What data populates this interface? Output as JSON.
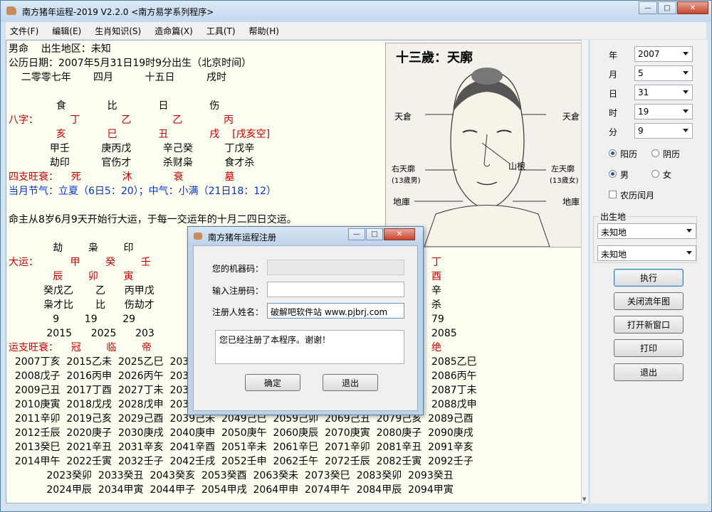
{
  "app": {
    "title": "南方猪年运程-2019  V2.2.0 <南方易学系列程序>",
    "close_glyph": "✕",
    "min_glyph": "—",
    "max_glyph": "□"
  },
  "menu": [
    "文件(F)",
    "编辑(E)",
    "生肖知识(S)",
    "造命篇(X)",
    "工具(T)",
    "帮助(H)"
  ],
  "lines": [
    {
      "t": "男命    出生地区：未知",
      "c": ""
    },
    {
      "t": "公历日期：2007年5月31日19时9分出生（北京时间）",
      "c": ""
    },
    {
      "t": "    二零零七年       四月          十五日          戌时",
      "c": ""
    },
    {
      "t": "",
      "c": ""
    },
    {
      "t": "               食             比             日             伤",
      "c": ""
    },
    {
      "t": "八字：          丁             乙             乙             丙",
      "c": "red"
    },
    {
      "t": "               亥             巳             丑             戌    [戌亥空]",
      "c": "red"
    },
    {
      "t": "             甲壬          庚丙戊          辛己癸          丁戊辛",
      "c": ""
    },
    {
      "t": "             劫印          官伤才          杀财枭          食才杀",
      "c": ""
    },
    {
      "t": "四支旺衰：    死             沐             衰             墓",
      "c": "red"
    },
    {
      "t": "当月节气：立夏（6日5：20）；中气：小满（21日18：12）",
      "c": "blue"
    },
    {
      "t": "",
      "c": ""
    },
    {
      "t": "命主从8岁6月9天开始行大运，于每一交运年的十月二四日交运。",
      "c": ""
    },
    {
      "t": "",
      "c": ""
    },
    {
      "t": "              劫        枭        印",
      "c": ""
    },
    {
      "t": "大运：          甲        癸        壬",
      "c": "red"
    },
    {
      "t": "              辰        卯        寅",
      "c": "red"
    },
    {
      "t": "           癸戊乙       乙      丙甲戊",
      "c": ""
    },
    {
      "t": "           枭才比       比      伤劫才",
      "c": ""
    },
    {
      "t": "              9        19        29",
      "c": ""
    },
    {
      "t": "            2015      2025      203",
      "c": ""
    },
    {
      "t": "运支旺衰：    冠        临        帝",
      "c": "red"
    },
    {
      "t": "  2007丁亥  2015乙未  2025乙巳  203",
      "c": ""
    },
    {
      "t": "  2008戊子  2016丙申  2026丙午  203",
      "c": ""
    },
    {
      "t": "  2009己丑  2017丁酉  2027丁未  203",
      "c": ""
    },
    {
      "t": "  2010庚寅  2018戊戌  2028戊申  203",
      "c": ""
    },
    {
      "t": "  2011辛卯  2019己亥  2029己酉  2039己未  2049己巳  2059己卯  2069己丑  2079己亥  2089己酉",
      "c": ""
    },
    {
      "t": "  2012壬辰  2020庚子  2030庚戌  2040庚申  2050庚午  2060庚辰  2070庚寅  2080庚子  2090庚戌",
      "c": ""
    },
    {
      "t": "  2013癸巳  2021辛丑  2031辛亥  2041辛酉  2051辛未  2061辛巳  2071辛卯  2081辛丑  2091辛亥",
      "c": ""
    },
    {
      "t": "  2014甲午  2022壬寅  2032壬子  2042壬戌  2052壬申  2062壬午  2072壬辰  2082壬寅  2092壬子",
      "c": ""
    },
    {
      "t": "            2023癸卯  2033癸丑  2043癸亥  2053癸酉  2063癸未  2073癸巳  2083癸卯  2093癸丑",
      "c": ""
    },
    {
      "t": "            2024甲辰  2034甲寅  2044甲子  2054甲戌  2064甲申  2074甲午  2084甲辰  2094甲寅",
      "c": ""
    }
  ],
  "right_col": [
    {
      "t": "丁",
      "c": "red"
    },
    {
      "t": "酉",
      "c": "red"
    },
    {
      "t": "辛",
      "c": ""
    },
    {
      "t": "杀",
      "c": ""
    },
    {
      "t": "79",
      "c": ""
    },
    {
      "t": "2085",
      "c": ""
    },
    {
      "t": "绝",
      "c": "red"
    },
    {
      "t": "2085乙巳",
      "c": ""
    },
    {
      "t": "2086丙午",
      "c": ""
    },
    {
      "t": "2087丁未",
      "c": ""
    },
    {
      "t": "2088戊申",
      "c": ""
    }
  ],
  "portrait": {
    "title": "十三歲：天廓",
    "labels": [
      "天倉",
      "天倉",
      "右天廓",
      "(13歲男)",
      "山根",
      "左天廓",
      "(13歲女)",
      "地庫",
      "地庫"
    ]
  },
  "panel": {
    "year_label": "年",
    "year": "2007",
    "month_label": "月",
    "month": "5",
    "day_label": "日",
    "day": "31",
    "hour_label": "时",
    "hour": "19",
    "minute_label": "分",
    "minute": "9",
    "solar": "阳历",
    "lunar": "阴历",
    "male": "男",
    "female": "女",
    "leap": "农历闰月",
    "birthplace_label": "出生地",
    "place1": "未知地",
    "place2": "未知地",
    "btn_run": "执行",
    "btn_close_chart": "关闭流年图",
    "btn_new": "打开新窗口",
    "btn_print": "打印",
    "btn_exit": "退出"
  },
  "dialog": {
    "title": "南方猪年运程注册",
    "machine_label": "您的机器码：",
    "machine_value": "",
    "code_label": "输入注册码：",
    "code_value": "",
    "name_label": "注册人姓名：",
    "name_value": "破解吧软件站 www.pjbrj.com",
    "message": "您已经注册了本程序。谢谢！",
    "ok": "确定",
    "exit": "退出"
  }
}
